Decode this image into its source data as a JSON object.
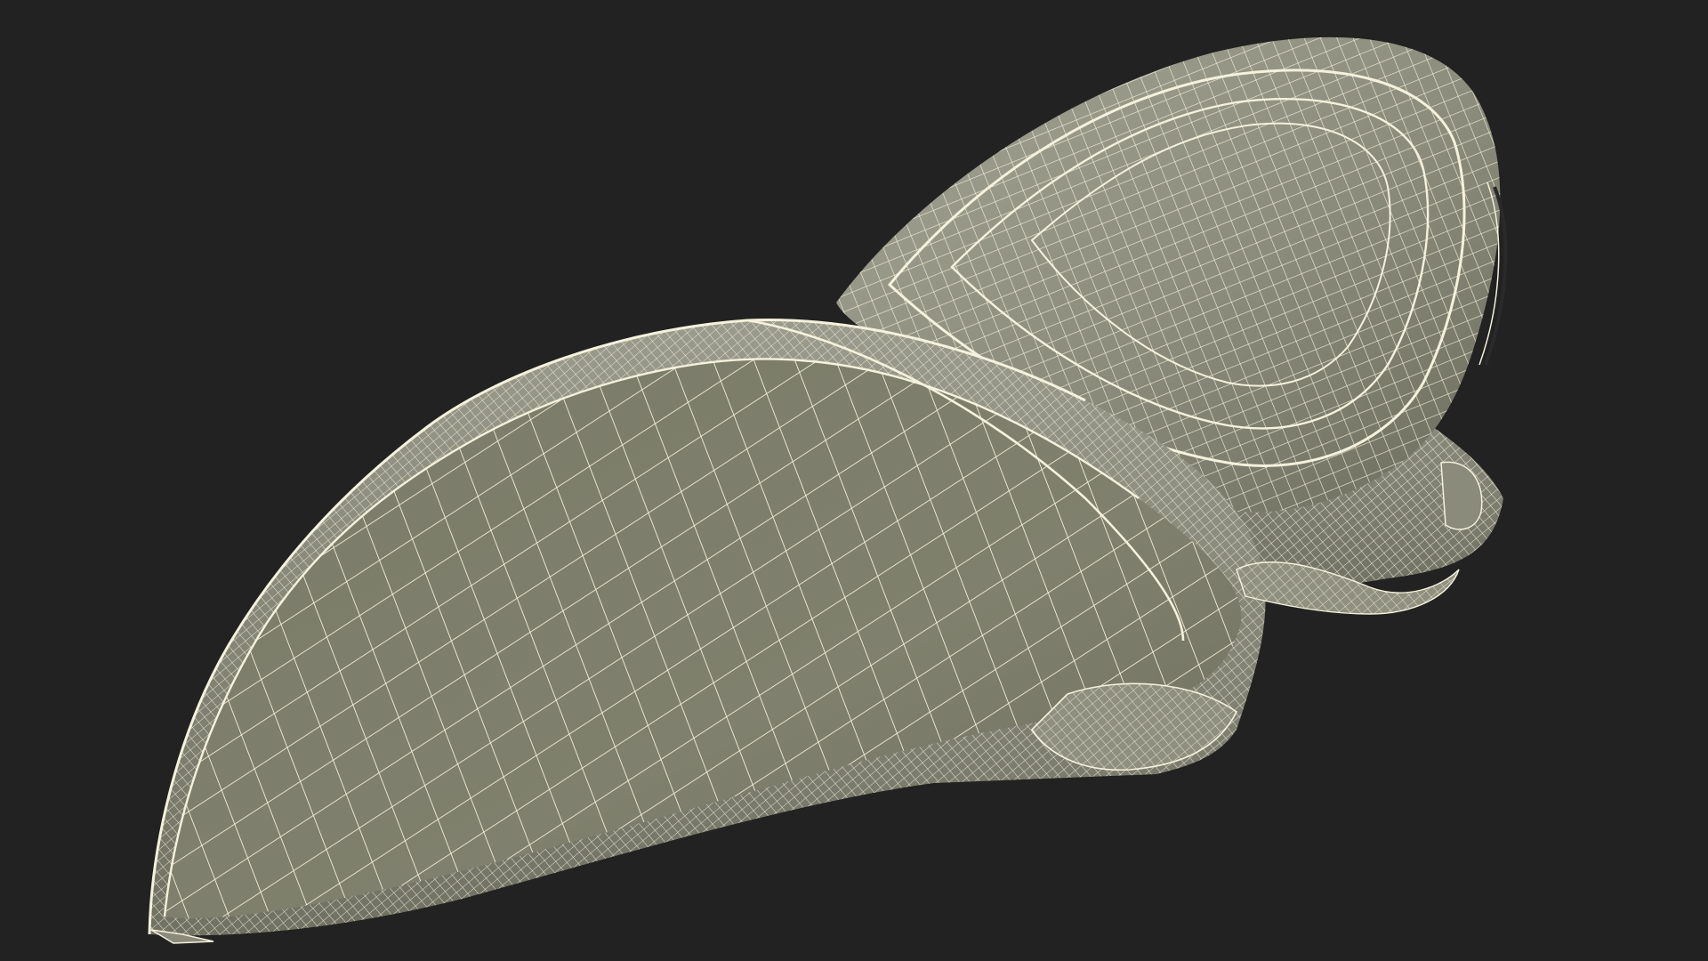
{
  "scene": {
    "background_color": "#222222",
    "surface_color": "#7c7d6a",
    "surface_light_color": "#97988a",
    "surface_dark_color": "#5f6052",
    "wire_color": "#f4f1dc"
  },
  "objects": [
    {
      "name": "front-shell-wireframe"
    },
    {
      "name": "rear-cap-wireframe"
    }
  ]
}
